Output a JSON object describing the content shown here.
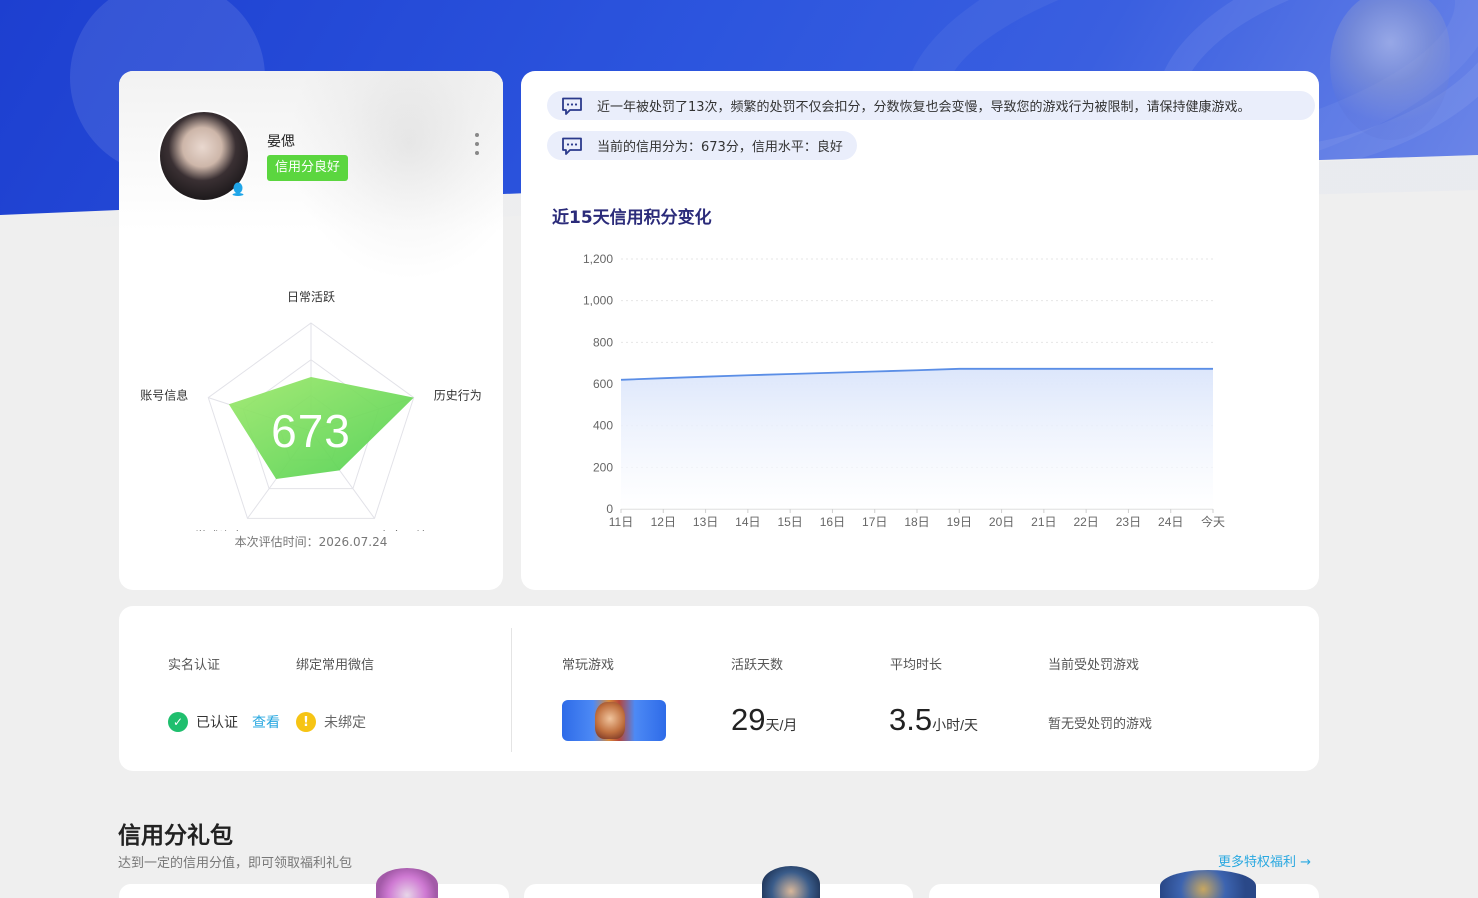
{
  "profile": {
    "username": "晏偲",
    "credit_tag": "信用分良好",
    "score": "673",
    "eval_time": "本次评估时间：2026.07.24",
    "radar": {
      "labels": [
        "日常活跃",
        "历史行为",
        "安全贡献",
        "游戏资产",
        "账号信息"
      ],
      "values": [
        0.5,
        1.0,
        0.45,
        0.55,
        0.8
      ]
    }
  },
  "notices": [
    "近一年被处罚了13次，频繁的处罚不仅会扣分，分数恢复也会变慢，导致您的游戏行为被限制，请保持健康游戏。",
    "当前的信用分为：673分，信用水平：良好"
  ],
  "chart_title": "近15天信用积分变化",
  "chart_data": {
    "type": "area",
    "title": "近15天信用积分变化",
    "x": [
      "11日",
      "12日",
      "13日",
      "14日",
      "15日",
      "16日",
      "17日",
      "18日",
      "19日",
      "20日",
      "21日",
      "22日",
      "23日",
      "24日",
      "今天"
    ],
    "y": [
      620,
      628,
      635,
      642,
      648,
      654,
      660,
      666,
      673,
      673,
      673,
      673,
      673,
      673,
      673
    ],
    "ylim": [
      0,
      1200
    ],
    "yticks": [
      "0",
      "200",
      "400",
      "600",
      "800",
      "1,000",
      "1,200"
    ],
    "grid": true,
    "line_color": "#5b8ee6",
    "fill_color": "#dce6fb"
  },
  "stats": {
    "realname_label": "实名认证",
    "wechat_label": "绑定常用微信",
    "realname_status": "已认证",
    "view_link": "查看",
    "wechat_status": "未绑定",
    "games_label": "常玩游戏",
    "active_days_label": "活跃天数",
    "active_days_value": "29",
    "active_days_unit": "天/月",
    "avg_time_label": "平均时长",
    "avg_time_value": "3.5",
    "avg_time_unit": "小时/天",
    "punished_label": "当前受处罚游戏",
    "punished_value": "暂无受处罚的游戏"
  },
  "gift": {
    "title": "信用分礼包",
    "subtitle": "达到一定的信用分值，即可领取福利礼包",
    "more_link": "更多特权福利 →"
  },
  "icons": {
    "check": "✓",
    "warn": "!",
    "qq": "♟"
  },
  "colors": {
    "accent": "#29a8e0",
    "good": "#5bd63f",
    "header": "#2c55de"
  }
}
